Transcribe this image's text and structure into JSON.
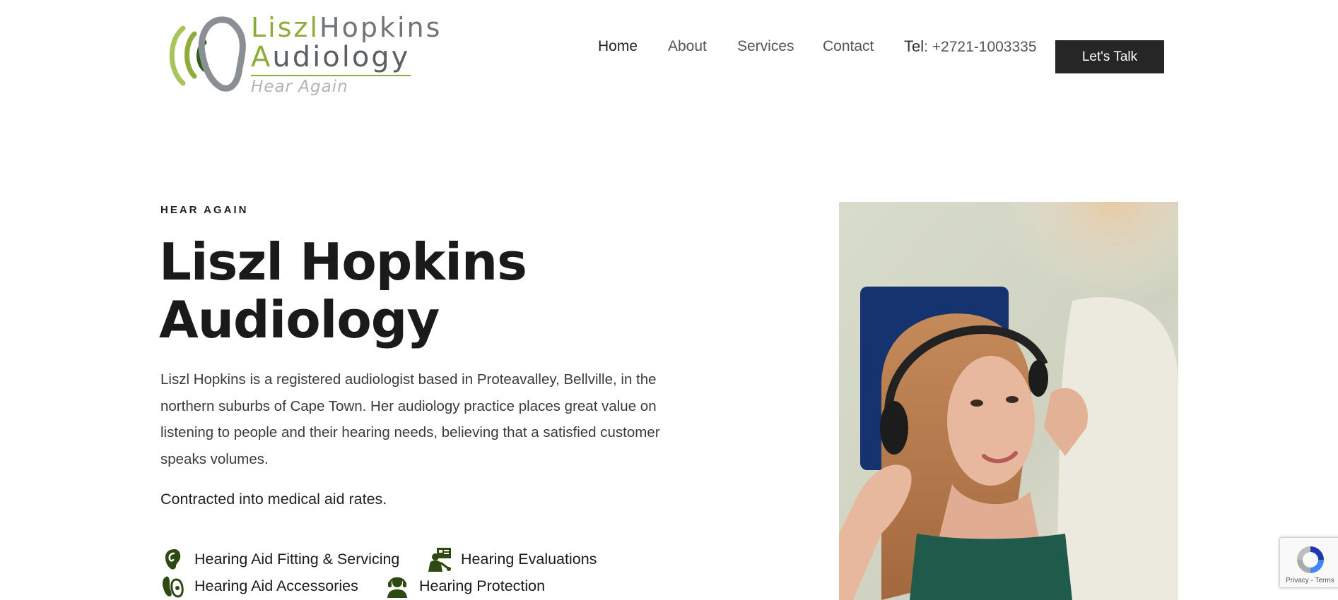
{
  "header": {
    "logo": {
      "line1_a": "Liszl",
      "line1_b": "Hopkins",
      "line2_a": "A",
      "line2_b": "udiology",
      "tagline": "Hear Again"
    },
    "nav": [
      {
        "label": "Home",
        "active": true
      },
      {
        "label": "About",
        "active": false
      },
      {
        "label": "Services",
        "active": false
      },
      {
        "label": "Contact",
        "active": false
      }
    ],
    "tel_label": "Tel",
    "tel_number": ": +2721-1003335",
    "cta_label": "Let's Talk"
  },
  "hero": {
    "eyebrow": "HEAR AGAIN",
    "title_line1": "Liszl Hopkins",
    "title_line2": "Audiology",
    "intro": "Liszl Hopkins is a registered audiologist based in Proteavalley, Bellville, in the northern suburbs of Cape Town. Her audiology practice places great value on listening to people and their hearing needs, believing that a satisfied customer speaks volumes.",
    "contracted": "Contracted into medical aid rates.",
    "services": [
      {
        "label": "Hearing Aid Fitting & Servicing",
        "icon": "ear-icon"
      },
      {
        "label": "Hearing Evaluations",
        "icon": "audiologist-icon"
      },
      {
        "label": "Hearing Aid Accessories",
        "icon": "hearing-aid-icon"
      },
      {
        "label": "Hearing Protection",
        "icon": "headset-person-icon"
      }
    ]
  },
  "recaptcha": {
    "links": "Privacy - Terms"
  },
  "colors": {
    "brand_green": "#8dac3c",
    "dark_green": "#2f5a1a",
    "logo_grey": "#8a8f93",
    "icon_green": "#2d4a12",
    "cta_bg": "#262626"
  }
}
